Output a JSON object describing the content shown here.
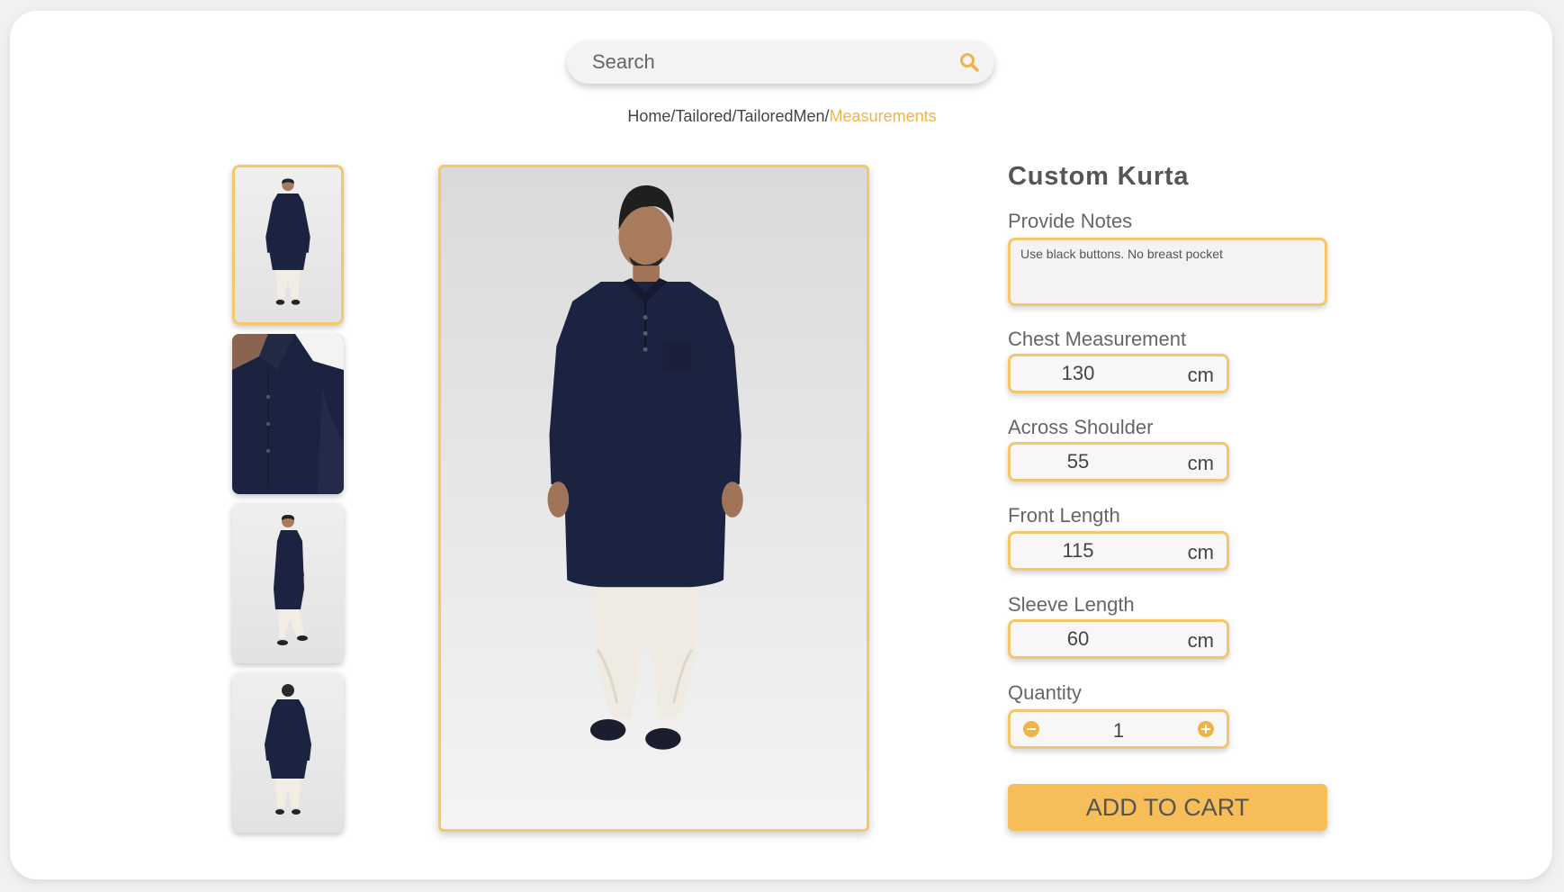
{
  "search": {
    "placeholder": "Search",
    "icon": "search-icon"
  },
  "breadcrumb": [
    {
      "label": "Home",
      "sep": "/"
    },
    {
      "label": "Tailored",
      "sep": "/"
    },
    {
      "label": "TailoredMen",
      "sep": "/"
    },
    {
      "label": "Measurements",
      "sep": ""
    }
  ],
  "product": {
    "title": "Custom Kurta",
    "notes_label": "Provide Notes",
    "notes_value": "Use black buttons. No breast pocket",
    "measurements": [
      {
        "label": "Chest Measurement",
        "value": "130",
        "unit": "cm"
      },
      {
        "label": "Across Shoulder",
        "value": "55",
        "unit": "cm"
      },
      {
        "label": "Front Length",
        "value": "115",
        "unit": "cm"
      },
      {
        "label": "Sleeve Length",
        "value": "60",
        "unit": "cm"
      }
    ],
    "quantity_label": "Quantity",
    "quantity": "1",
    "add_to_cart": "ADD TO CART"
  },
  "gallery": {
    "thumbnails": [
      "front-view",
      "collar-closeup",
      "side-view",
      "back-view"
    ],
    "active_index": 0
  },
  "colors": {
    "accent": "#f5c76a",
    "button": "#f6bd58",
    "kurta": "#1c2340"
  }
}
